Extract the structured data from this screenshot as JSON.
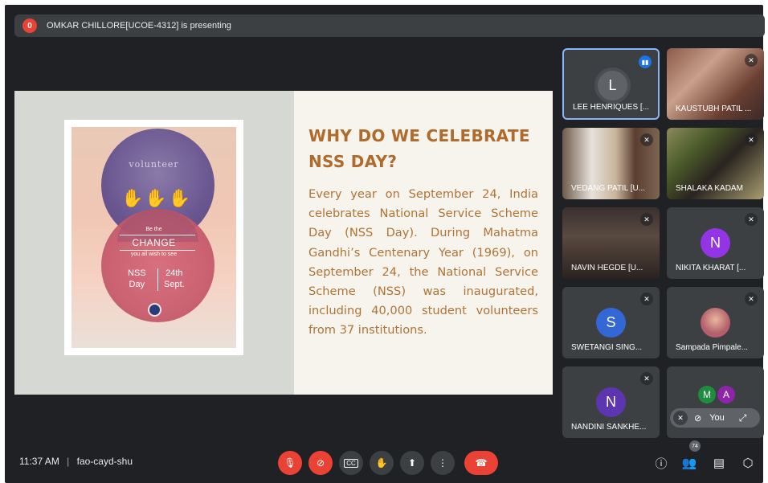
{
  "banner": {
    "icon": "present-icon",
    "badge": "0",
    "text": "OMKAR CHILLORE[UCOE-4312] is presenting"
  },
  "slide": {
    "poster": {
      "volunteer": "volunteer",
      "be_the": "Be the",
      "change": "CHANGE",
      "wish": "you all wish to see",
      "nss_line1": "NSS",
      "nss_line2": "Day",
      "date_line1": "24th",
      "date_line2": "Sept."
    },
    "title": "WHY DO WE CELEBRATE NSS DAY?",
    "body": "Every year on September 24, India celebrates National Service Scheme Day (NSS Day). During Mahatma Gandhi’s Centenary Year (1969), on September 24, the National Service Scheme (NSS) was inaugurated, including 40,000 student volunteers from 37 institutions."
  },
  "participants": [
    {
      "name": "LEE HENRIQUES [...",
      "initial": "L",
      "color": "#5f6368",
      "speaking": true
    },
    {
      "name": "KAUSTUBH PATIL ...",
      "video": true
    },
    {
      "name": "VEDANG PATIL [U...",
      "video": true
    },
    {
      "name": "SHALAKA KADAM",
      "video": true
    },
    {
      "name": "NAVIN HEGDE [U...",
      "video": true
    },
    {
      "name": "NIKITA KHARAT [...",
      "initial": "N",
      "color": "#9334e6"
    },
    {
      "name": "SWETANGI SING...",
      "initial": "S",
      "color": "#3367d6"
    },
    {
      "name": "Sampada Pimpale...",
      "photo": true
    },
    {
      "name": "NANDINI SANKHE...",
      "initial": "N",
      "color": "#5e35b1"
    }
  ],
  "self_tile": {
    "initial1": "M",
    "initial2": "A",
    "color1": "#1e8e3e",
    "color2": "#8e24aa",
    "label": "You"
  },
  "bottom": {
    "time": "11:37 AM",
    "separator": "|",
    "meeting_code": "fao-cayd-shu",
    "participant_count": "74"
  }
}
